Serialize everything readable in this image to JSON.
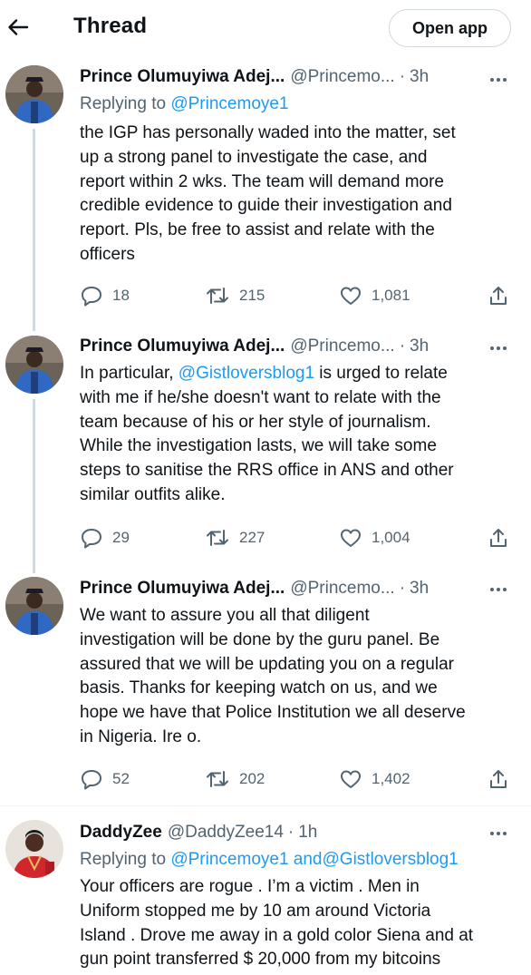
{
  "header": {
    "title": "Thread",
    "open_app_label": "Open app",
    "back_icon": "arrow-left-icon"
  },
  "tweets": [
    {
      "name": "Prince Olumuyiwa Adej...",
      "handle": "@Princemo...",
      "sep": "·",
      "time": "3h",
      "reply_prefix": "Replying to",
      "reply_to": "@Princemoye1",
      "text": [
        "the IGP has personally waded into the matter, set",
        "up a strong panel to investigate the case, and",
        "report within 2 wks. The team will demand more",
        "credible evidence to guide their investigation and",
        "report. Pls, be free to assist and relate with the",
        "officers"
      ],
      "replies": "18",
      "retweets": "215",
      "likes": "1,081"
    },
    {
      "name": "Prince Olumuyiwa Adej...",
      "handle": "@Princemo...",
      "sep": "·",
      "time": "3h",
      "line1_prefix": "In particular, ",
      "line1_mention": "@Gistloversblog1",
      "line1_suffix": " is urged to relate",
      "text": [
        "with me if he/she doesn't want to relate with the",
        "team because of his or her style of journalism.",
        "While the investigation lasts, we will take some",
        "steps to sanitise the RRS office in ANS and other",
        "similar outfits alike."
      ],
      "replies": "29",
      "retweets": "227",
      "likes": "1,004"
    },
    {
      "name": "Prince Olumuyiwa Adej...",
      "handle": "@Princemo...",
      "sep": "·",
      "time": "3h",
      "text": [
        "We want to assure you all that diligent",
        "investigation will be done by the guru panel. Be",
        "assured that we will be updating you on a regular",
        "basis. Thanks for keeping watch on us, and we",
        "hope we have that Police Institution we all deserve",
        "in Nigeria. Ire o."
      ],
      "replies": "52",
      "retweets": "202",
      "likes": "1,402"
    },
    {
      "name": "DaddyZee",
      "handle": "@DaddyZee14",
      "sep": "·",
      "time": "1h",
      "reply_prefix": "Replying to",
      "reply_to_1": "@Princemoye1",
      "reply_and": "and",
      "reply_to_2": "@Gistloversblog1",
      "text": [
        "Your officers are rogue . I’m a victim . Men in",
        "Uniform stopped me by 10 am around Victoria",
        "Island . Drove me away in a gold color Siena and at",
        "gun point transferred $ 20,000 from my bitcoins"
      ]
    }
  ],
  "colors": {
    "accent": "#1d9bf0",
    "text": "#0f1419",
    "muted": "#536471",
    "border": "#cfd9de"
  },
  "icons": {
    "reply": "reply-icon",
    "retweet": "retweet-icon",
    "like": "heart-icon",
    "share": "share-icon",
    "more": "more-icon"
  }
}
